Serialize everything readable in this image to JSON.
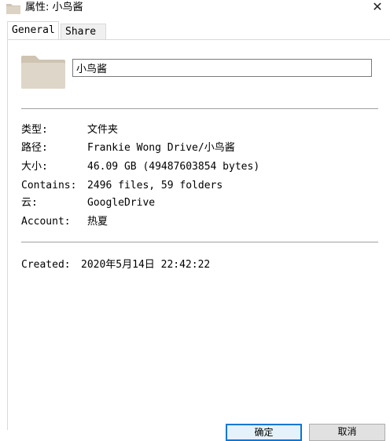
{
  "window": {
    "title": "属性: 小鸟酱",
    "close_glyph": "✕"
  },
  "tabs": [
    {
      "label": "General",
      "selected": true
    },
    {
      "label": "Share",
      "selected": false
    }
  ],
  "general": {
    "name_value": "小鸟酱",
    "properties": [
      {
        "label": "类型:",
        "value": "文件夹"
      },
      {
        "label": "路径:",
        "value": "Frankie Wong Drive/小鸟酱"
      },
      {
        "label": "大小:",
        "value": "46.09 GB (49487603854 bytes)"
      },
      {
        "label": "Contains:",
        "value": "2496 files, 59 folders"
      },
      {
        "label": "云:",
        "value": "GoogleDrive"
      },
      {
        "label": "Account:",
        "value": "热夏"
      }
    ],
    "created": {
      "label": "Created:",
      "value": "2020年5月14日 22:42:22"
    }
  },
  "buttons": {
    "ok_label": "确定",
    "cancel_label": "取消"
  },
  "colors": {
    "folder": "#dcd3c4",
    "folder_dark": "#cfc4b2",
    "accent": "#0078d7"
  }
}
